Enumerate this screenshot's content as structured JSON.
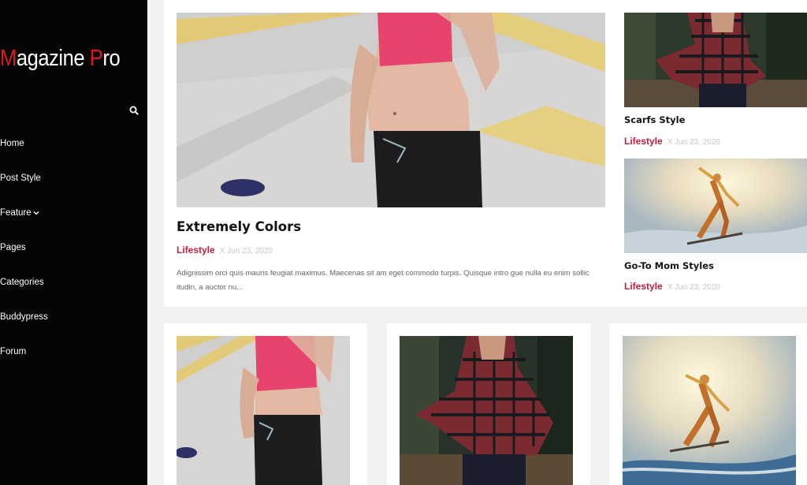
{
  "site": {
    "logo_part1": "M",
    "logo_part2": "agazine ",
    "logo_part3": "P",
    "logo_part4": "ro"
  },
  "nav": {
    "items": [
      {
        "label": "Home"
      },
      {
        "label": "Post Style"
      },
      {
        "label": "Feature"
      },
      {
        "label": "Pages"
      },
      {
        "label": "Categories"
      },
      {
        "label": "Buddypress"
      },
      {
        "label": "Forum"
      }
    ]
  },
  "featured": {
    "title": "Extremely Colors",
    "category": "Lifestyle",
    "date": "X Jun 23, 2020",
    "excerpt": "Adignissim orci quis mauris feugiat maximus. Maecenas sit am eget commodo turpis. Quisque intro gue nulla eu enim sollic itudin, a auctor nu..."
  },
  "side_posts": [
    {
      "title": "Scarfs Style",
      "category": "Lifestyle",
      "date": "X Jun 23, 2020"
    },
    {
      "title": "Go-To Mom Styles",
      "category": "Lifestyle",
      "date": "X Jun 23, 2020"
    }
  ],
  "colors": {
    "accent": "#c2213d",
    "logo_red": "#e3161f",
    "sidebar_bg": "#050505",
    "page_bg": "#f2f2f2"
  },
  "icons": {
    "search": "search-icon",
    "feature_dropdown": "chevron-down-icon"
  }
}
